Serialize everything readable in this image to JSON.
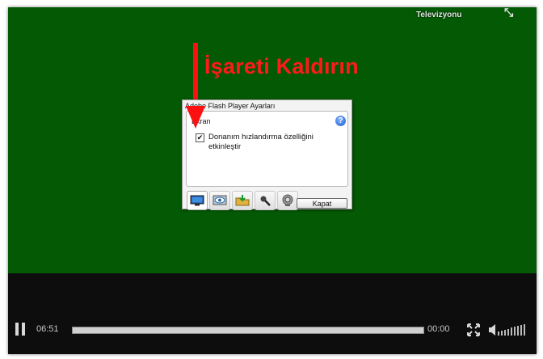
{
  "player": {
    "channel_label": "Televizyonu",
    "annotation": "İşareti Kaldırın",
    "time_current": "06:51",
    "time_total": "00:00",
    "progress_fraction": 1.0
  },
  "dialog": {
    "title": "Adobe Flash Player Ayarları",
    "panel_title": "Ekran",
    "checkbox_label": "Donanım hızlandırma özelliğini etkinleştir",
    "checkbox_checked": true,
    "checkmark": "✔",
    "help_glyph": "?",
    "close_label": "Kapat",
    "tabs": [
      {
        "name": "display",
        "icon": "monitor-icon",
        "active": true
      },
      {
        "name": "privacy",
        "icon": "eye-icon",
        "active": false
      },
      {
        "name": "storage",
        "icon": "folder-icon",
        "active": false
      },
      {
        "name": "microphone",
        "icon": "microphone-icon",
        "active": false
      },
      {
        "name": "camera",
        "icon": "webcam-icon",
        "active": false
      }
    ]
  },
  "colors": {
    "video_background": "#045a04",
    "annotation": "#ff1a1a"
  }
}
